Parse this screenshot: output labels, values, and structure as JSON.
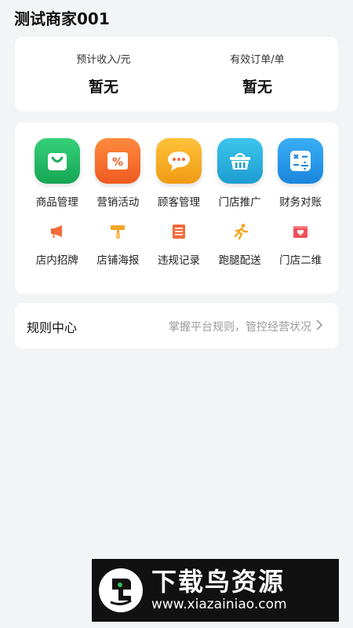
{
  "header": {
    "title": "测试商家001"
  },
  "stats": [
    {
      "label": "预计收入/元",
      "value": "暂无"
    },
    {
      "label": "有效订单/单",
      "value": "暂无"
    }
  ],
  "tools_primary": [
    {
      "label": "商品管理",
      "icon": "shopping-bag-icon",
      "color": "#22b864"
    },
    {
      "label": "营销活动",
      "icon": "coupon-icon",
      "color": "#f2672a"
    },
    {
      "label": "顾客管理",
      "icon": "chat-bubble-icon",
      "color": "#f2a31a"
    },
    {
      "label": "门店推广",
      "icon": "basket-icon",
      "color": "#23a7d8"
    },
    {
      "label": "财务对账",
      "icon": "calculator-icon",
      "color": "#2496e6"
    }
  ],
  "tools_secondary": [
    {
      "label": "店内招牌",
      "icon": "megaphone-icon",
      "color": "#f36b3a"
    },
    {
      "label": "店铺海报",
      "icon": "paint-roller-icon",
      "color": "#f5a623"
    },
    {
      "label": "违规记录",
      "icon": "document-list-icon",
      "color": "#f36b3a"
    },
    {
      "label": "跑腿配送",
      "icon": "runner-icon",
      "color": "#f5a623"
    },
    {
      "label": "门店二维",
      "icon": "heart-card-icon",
      "color": "#f0505a"
    }
  ],
  "rules": {
    "title": "规则中心",
    "description": "掌握平台规则，管控经营状况"
  },
  "watermark": {
    "brand": "下载鸟资源",
    "url": "www.xiazainiao.com"
  }
}
